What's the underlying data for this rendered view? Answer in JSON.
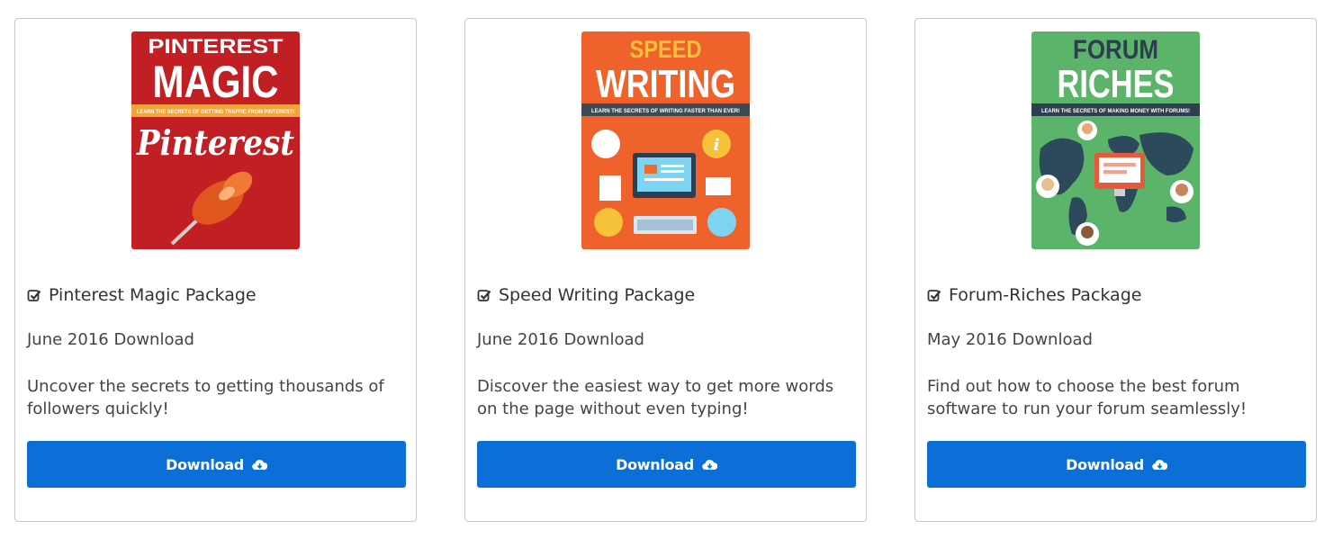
{
  "colors": {
    "button": "#0b6fd7",
    "border": "#c8c8c8",
    "text": "#444444"
  },
  "cards": [
    {
      "title": "Pinterest Magic Package",
      "date": "June 2016 Download",
      "description": "Uncover the secrets to getting thousands of followers quickly!",
      "button_label": "Download",
      "cover": {
        "line1": "PINTEREST",
        "line2": "MAGIC",
        "tagline": "LEARN THE SECRETS OF GETTING TRAFFIC FROM PINTEREST!",
        "brand": "Pinterest"
      }
    },
    {
      "title": "Speed Writing Package",
      "date": "June 2016 Download",
      "description": "Discover the easiest way to get more words on the page without even typing!",
      "button_label": "Download",
      "cover": {
        "line1": "SPEED",
        "line2": "WRITING",
        "tagline": "LEARN THE SECRETS OF WRITING FASTER THAN EVER!"
      }
    },
    {
      "title": "Forum-Riches Package",
      "date": "May 2016 Download",
      "description": "Find out how to choose the best forum software to run your forum seamlessly!",
      "button_label": "Download",
      "cover": {
        "line1": "FORUM",
        "line2": "RICHES",
        "tagline": "LEARN THE SECRETS OF MAKING MONEY WITH FORUMS!"
      }
    }
  ]
}
